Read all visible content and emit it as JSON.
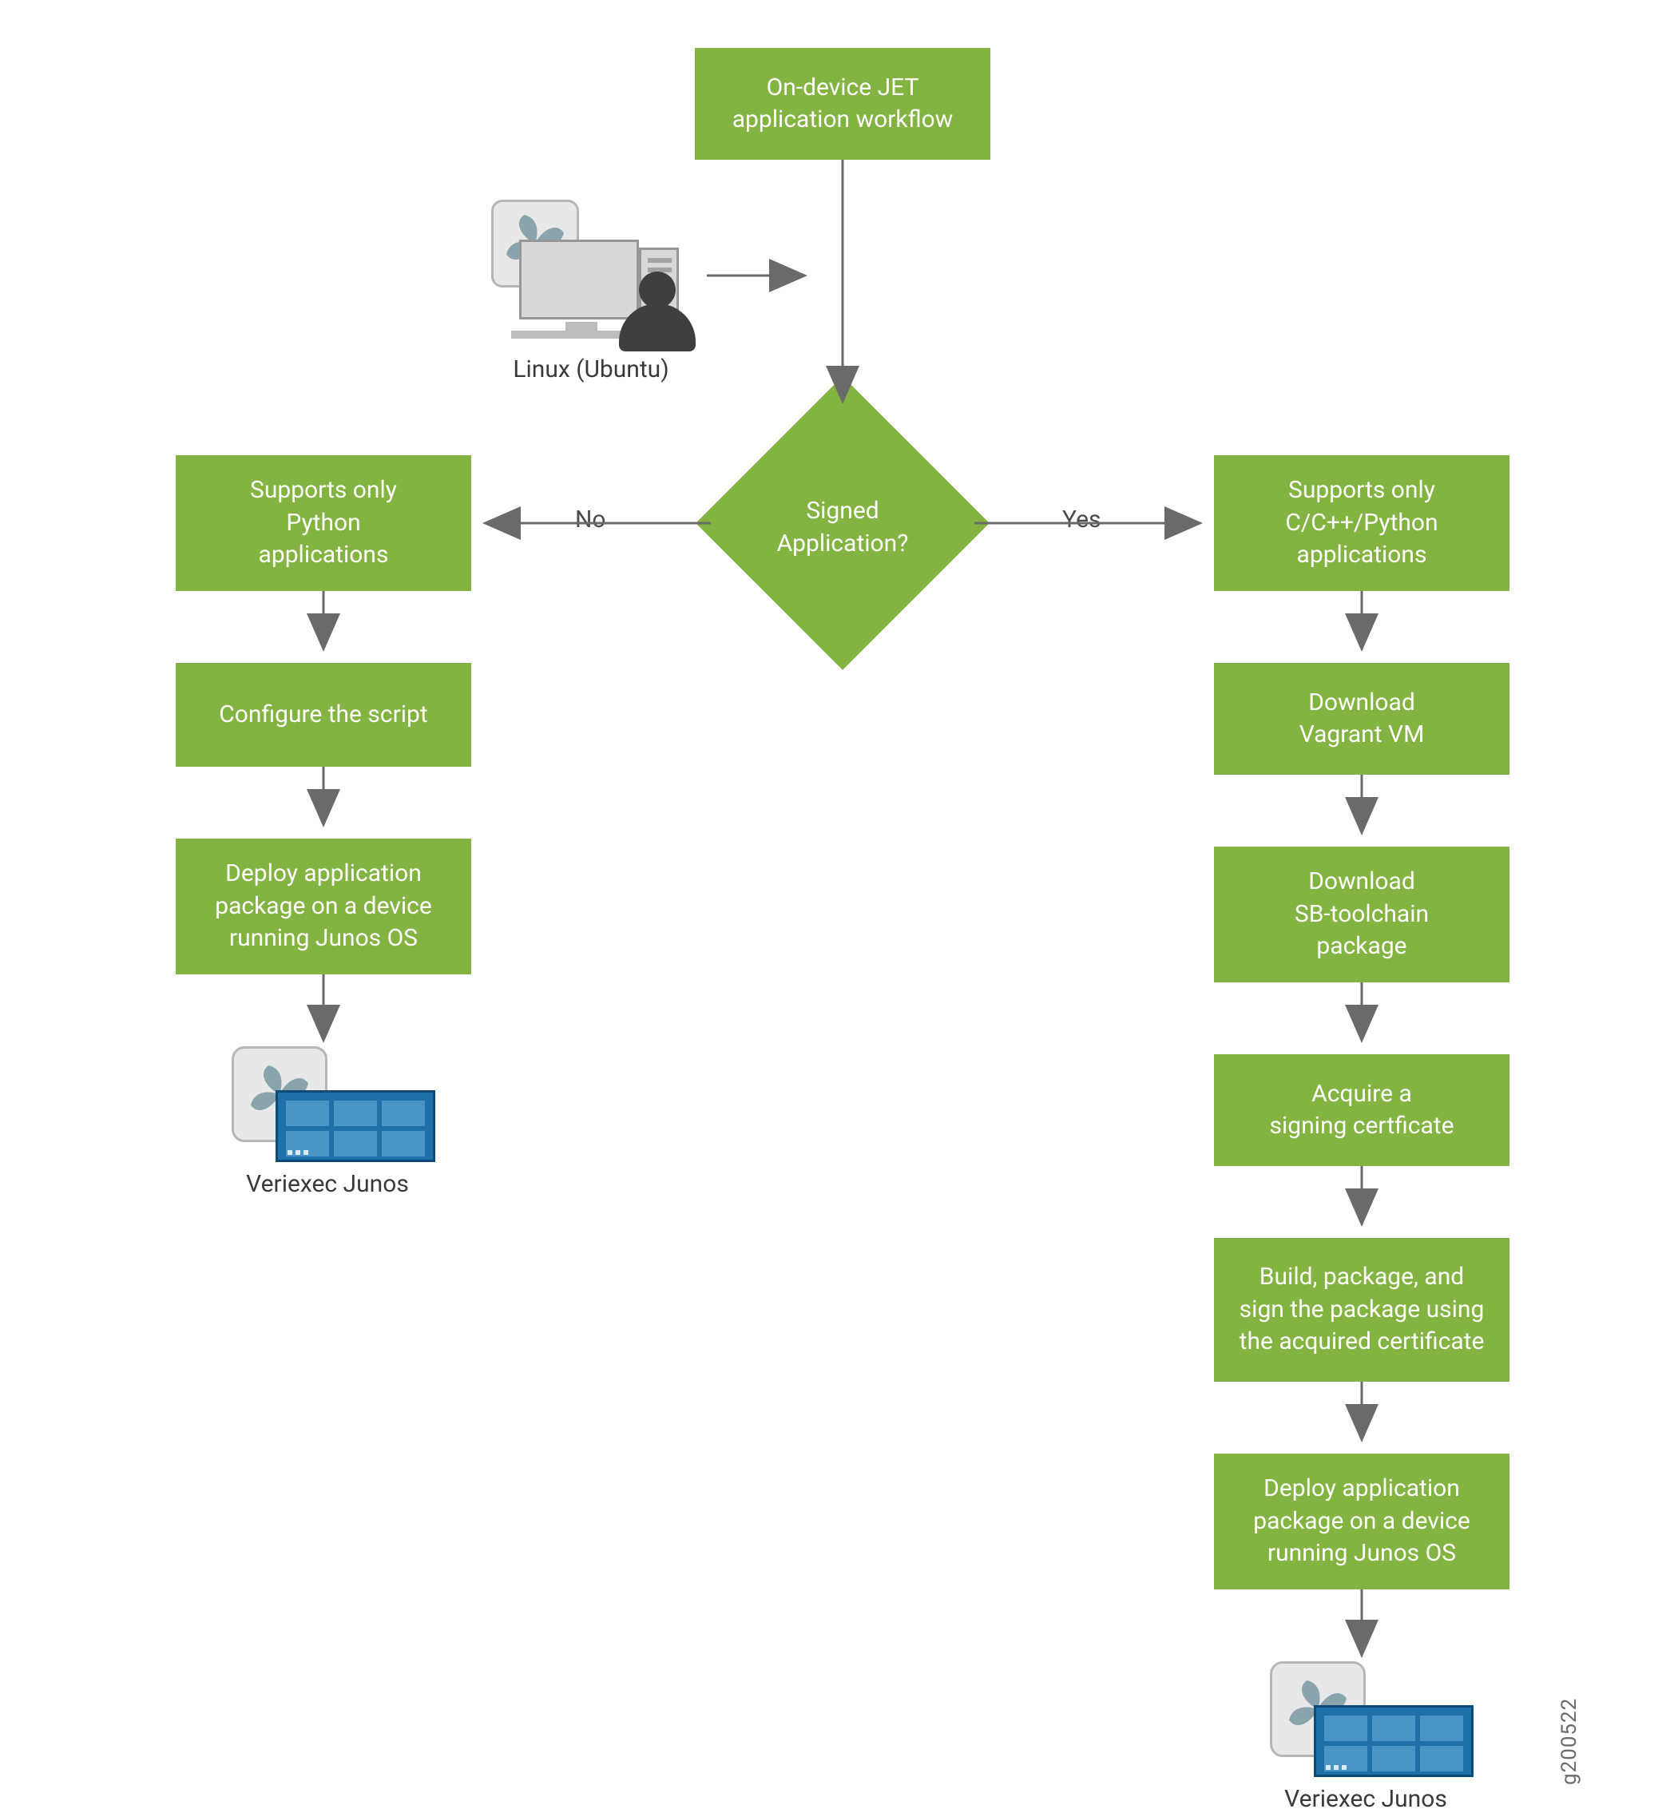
{
  "figure_id": "g200522",
  "nodes": {
    "start": "On-device JET\napplication workflow",
    "decision": "Signed\nApplication?",
    "no_branch": [
      "Supports only\nPython\napplications",
      "Configure the script",
      "Deploy application\npackage on a device\nrunning Junos OS"
    ],
    "yes_branch": [
      "Supports only\nC/C++/Python\napplications",
      "Download\nVagrant VM",
      "Download\nSB-toolchain\npackage",
      "Acquire a\nsigning certficate",
      "Build, package, and\nsign the package using\nthe acquired certificate",
      "Deploy application\npackage on a device\nrunning Junos OS"
    ]
  },
  "edge_labels": {
    "no": "No",
    "yes": "Yes"
  },
  "captions": {
    "linux": "Linux (Ubuntu)",
    "veriexec": "Veriexec Junos"
  },
  "colors": {
    "node_fill": "#83b340",
    "node_text": "#ffffff",
    "edge": "#6a6a6a"
  }
}
